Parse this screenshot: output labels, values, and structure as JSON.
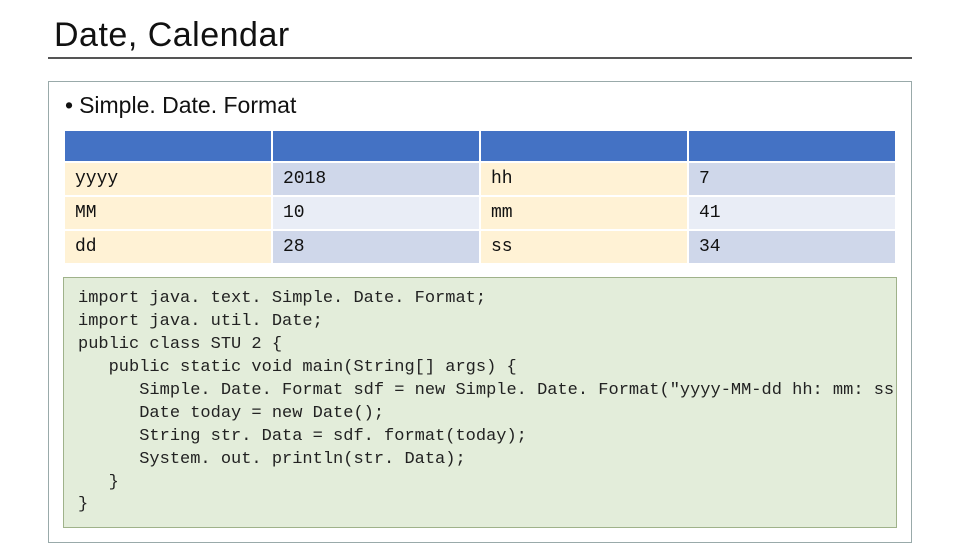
{
  "title": "Date, Calendar",
  "bullet": "Simple. Date. Format",
  "table": {
    "rows": [
      {
        "c0": "yyyy",
        "c1": "2018",
        "c2": "hh",
        "c3": "7"
      },
      {
        "c0": "MM",
        "c1": "10",
        "c2": "mm",
        "c3": "41"
      },
      {
        "c0": "dd",
        "c1": "28",
        "c2": "ss",
        "c3": "34"
      }
    ]
  },
  "code": "import java. text. Simple. Date. Format;\nimport java. util. Date;\npublic class STU 2 {\n   public static void main(String[] args) {\n      Simple. Date. Format sdf = new Simple. Date. Format(\"yyyy-MM-dd hh: mm: ss\");\n      Date today = new Date();\n      String str. Data = sdf. format(today);\n      System. out. println(str. Data);\n   }\n}"
}
